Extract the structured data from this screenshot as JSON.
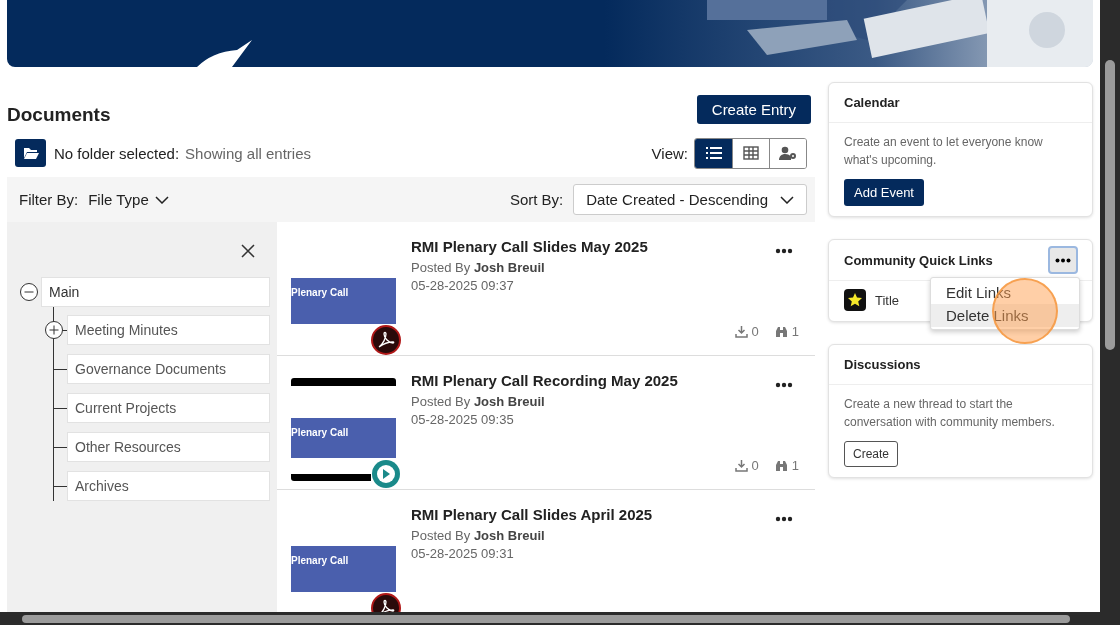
{
  "documents": {
    "title": "Documents",
    "create_button": "Create Entry",
    "folder_status": {
      "label": "No folder selected:",
      "value": "Showing all entries"
    },
    "view": {
      "label": "View:",
      "options": [
        {
          "kind": "list",
          "selected": true
        },
        {
          "kind": "grid",
          "selected": false
        },
        {
          "kind": "people",
          "selected": false
        }
      ]
    },
    "filter": {
      "label": "Filter By:",
      "value": "File Type"
    },
    "sort": {
      "label": "Sort By:",
      "value": "Date Created - Descending"
    },
    "tree": {
      "label": "Main",
      "expanded": true,
      "children": [
        {
          "label": "Meeting Minutes",
          "kind": "expandable",
          "expanded": false
        },
        {
          "label": "Governance Documents",
          "kind": "leaf"
        },
        {
          "label": "Current Projects",
          "kind": "leaf"
        },
        {
          "label": "Other Resources",
          "kind": "leaf"
        },
        {
          "label": "Archives",
          "kind": "leaf"
        }
      ]
    },
    "entries": [
      {
        "title": "RMI Plenary Call Slides May 2025",
        "posted_by_label": "Posted By",
        "author": "Josh Breuil",
        "date": "05-28-2025 09:37",
        "thumb_text": "Plenary Call",
        "kind": "pdf",
        "downloads": "0",
        "views": "1"
      },
      {
        "title": "RMI Plenary Call Recording May 2025",
        "posted_by_label": "Posted By",
        "author": "Josh Breuil",
        "date": "05-28-2025 09:35",
        "thumb_text": "Plenary Call",
        "kind": "video",
        "downloads": "0",
        "views": "1"
      },
      {
        "title": "RMI Plenary Call Slides April 2025",
        "posted_by_label": "Posted By",
        "author": "Josh Breuil",
        "date": "05-28-2025 09:31",
        "thumb_text": "Plenary Call",
        "kind": "pdf"
      }
    ]
  },
  "calendar": {
    "title": "Calendar",
    "text": "Create an event to let everyone know what's upcoming.",
    "button": "Add Event"
  },
  "quick_links": {
    "title": "Community Quick Links",
    "links": [
      {
        "label": "Title"
      }
    ],
    "menu": [
      {
        "label": "Edit Links",
        "highlighted": false
      },
      {
        "label": "Delete Links",
        "highlighted": true
      }
    ]
  },
  "discussions": {
    "title": "Discussions",
    "text": "Create a new thread to start the conversation with community members.",
    "button": "Create"
  }
}
